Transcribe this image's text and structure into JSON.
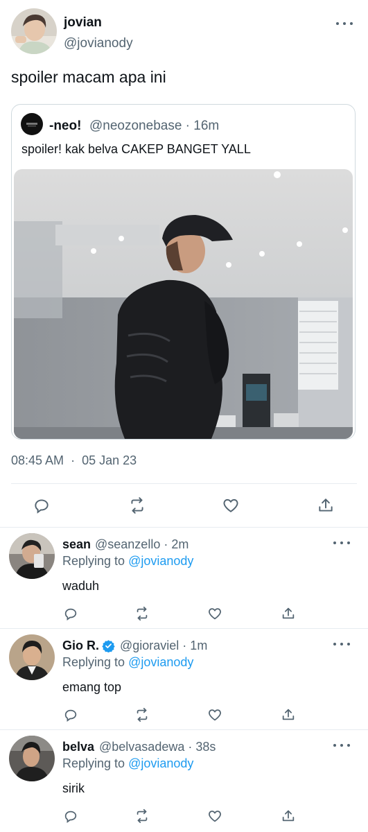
{
  "main_tweet": {
    "display_name": "jovian",
    "handle": "@jovianody",
    "text": "spoiler macam apa ini",
    "avatar_icon": "user-avatar-photo",
    "more_icon": "more-horizontal-icon"
  },
  "quoted_tweet": {
    "display_name": "-neo!",
    "meta": "@neozonebase · 16m",
    "text": "spoiler! kak belva CAKEP BANGET YALL",
    "avatar_icon": "neozone-logo-avatar",
    "media_icon": "dance-studio-photo"
  },
  "timestamp": {
    "time": "08:45 AM",
    "separator": "·",
    "date": "05 Jan 23"
  },
  "actions": [
    "reply-icon",
    "retweet-icon",
    "like-icon",
    "share-icon"
  ],
  "replies": [
    {
      "display_name": "sean",
      "meta": "@seanzello · 2m",
      "replying_label": "Replying to",
      "replying_to": "@jovianody",
      "text": "waduh",
      "verified": false
    },
    {
      "display_name": "Gio R.",
      "meta": "@gioraviel · 1m",
      "replying_label": "Replying to",
      "replying_to": "@jovianody",
      "text": "emang top",
      "verified": true
    },
    {
      "display_name": "belva",
      "meta": "@belvasadewa · 38s",
      "replying_label": "Replying to",
      "replying_to": "@jovianody",
      "text": "sirik",
      "verified": false
    }
  ],
  "colors": {
    "accent": "#1d9bf0",
    "secondary_text": "#536471",
    "divider": "#e7ecf0"
  }
}
